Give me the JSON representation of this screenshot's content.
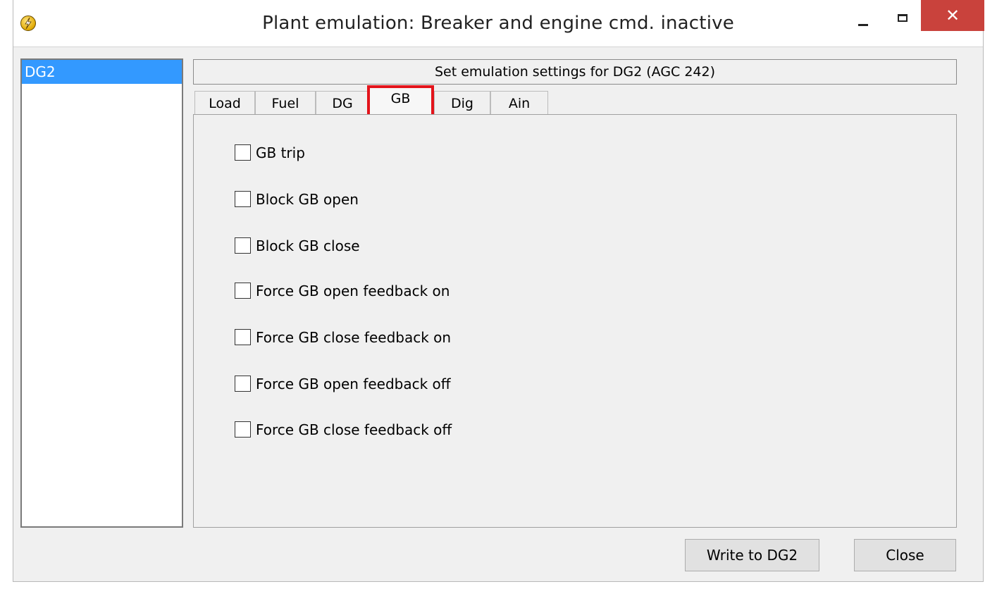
{
  "window": {
    "title": "Plant emulation: Breaker and engine cmd. inactive",
    "close_glyph": "✕"
  },
  "device_list": {
    "items": [
      {
        "label": "DG2",
        "selected": true
      }
    ]
  },
  "settings_header": "Set emulation settings for DG2 (AGC 242)",
  "tabs": [
    {
      "label": "Load",
      "active": false
    },
    {
      "label": "Fuel",
      "active": false
    },
    {
      "label": "DG",
      "active": false
    },
    {
      "label": "GB",
      "active": true
    },
    {
      "label": "Dig",
      "active": false
    },
    {
      "label": "Ain",
      "active": false
    }
  ],
  "gb_options": [
    {
      "label": "GB trip",
      "checked": false
    },
    {
      "label": "Block GB open",
      "checked": false
    },
    {
      "label": "Block GB close",
      "checked": false
    },
    {
      "label": "Force GB open feedback on",
      "checked": false
    },
    {
      "label": "Force GB close feedback on",
      "checked": false
    },
    {
      "label": "Force GB open feedback off",
      "checked": false
    },
    {
      "label": "Force GB close feedback off",
      "checked": false
    }
  ],
  "buttons": {
    "write": "Write to DG2",
    "close": "Close"
  },
  "colors": {
    "selection": "#3399ff",
    "active_tab_highlight": "#e3141b",
    "close_button": "#c9423c"
  }
}
